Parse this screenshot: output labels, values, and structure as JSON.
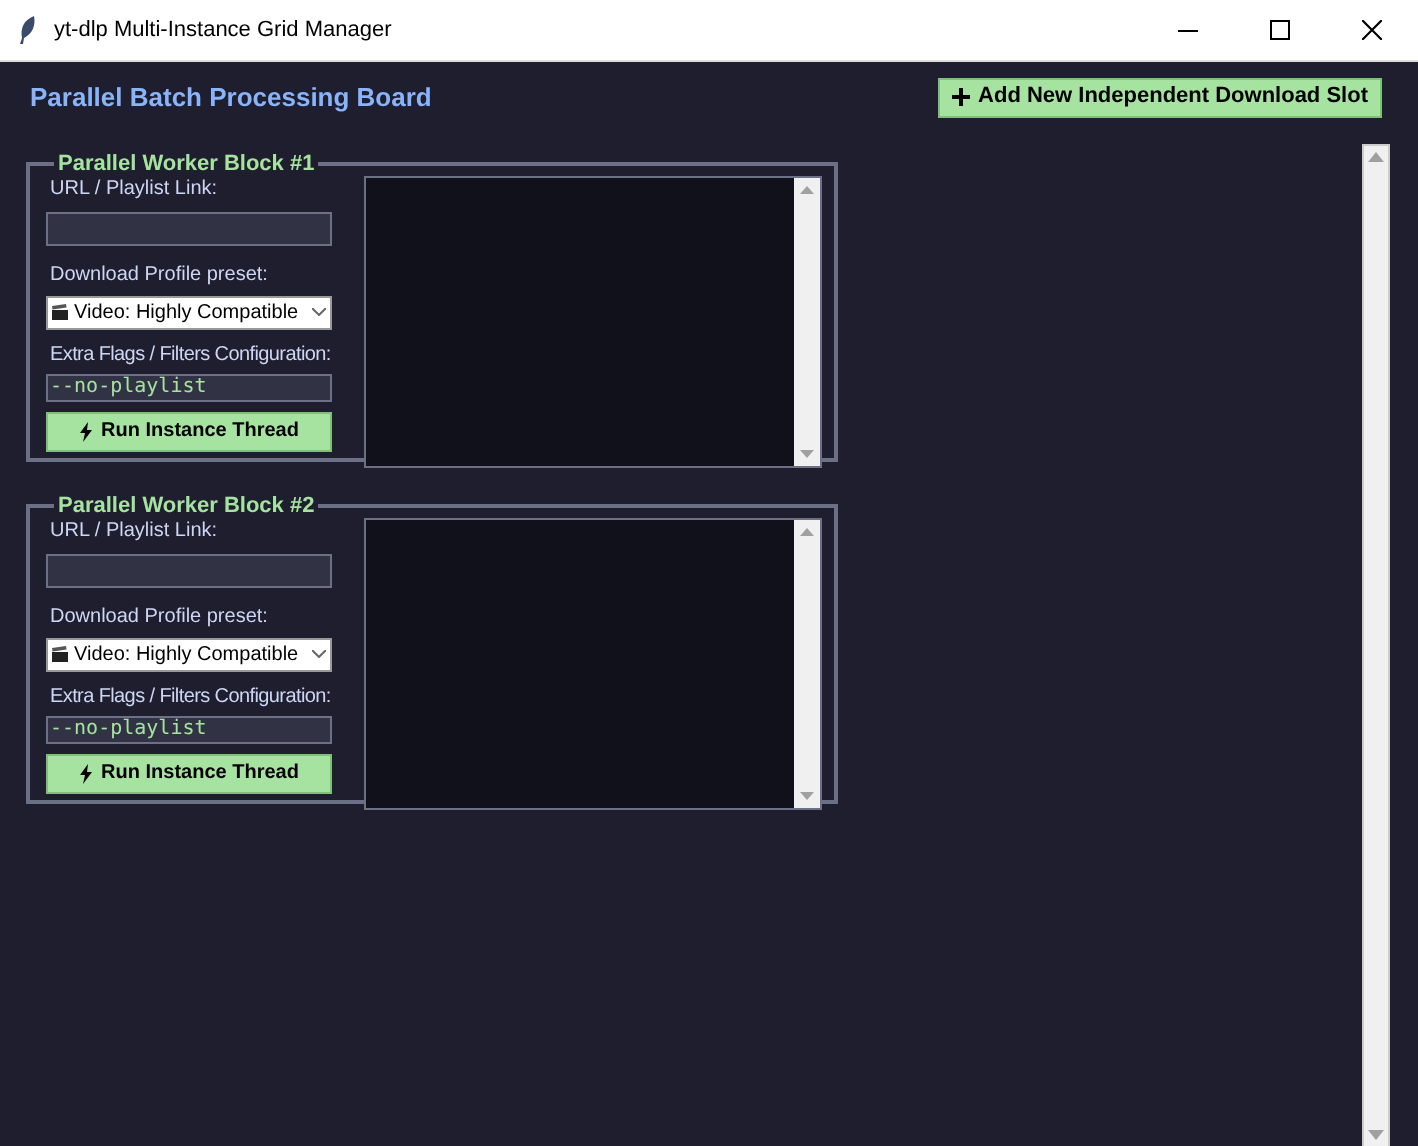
{
  "window": {
    "title": "yt-dlp Multi-Instance Grid Manager"
  },
  "header": {
    "title": "Parallel Batch Processing Board",
    "add_button": "Add New Independent Download Slot"
  },
  "workers": [
    {
      "title": "Parallel Worker Block #1",
      "url_label": "URL / Playlist Link:",
      "profile_label": "Download Profile preset:",
      "profile_value": "Video: Highly Compatible",
      "flags_label": "Extra Flags / Filters Configuration:",
      "flags_value": "--no-playlist",
      "run_button": "Run Instance Thread"
    },
    {
      "title": "Parallel Worker Block #2",
      "url_label": "URL / Playlist Link:",
      "profile_label": "Download Profile preset:",
      "profile_value": "Video: Highly Compatible",
      "flags_label": "Extra Flags / Filters Configuration:",
      "flags_value": "--no-playlist",
      "run_button": "Run Instance Thread"
    }
  ]
}
